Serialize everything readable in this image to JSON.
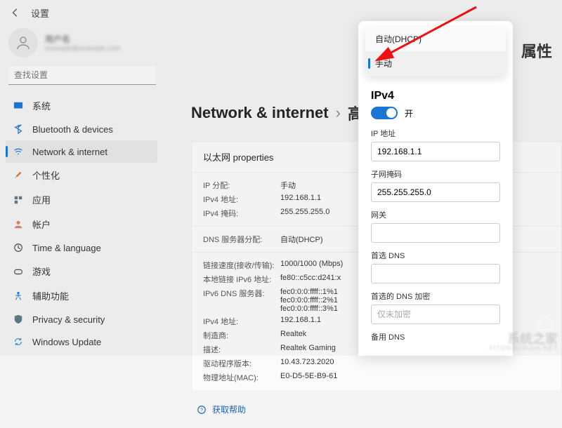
{
  "header": {
    "title": "设置"
  },
  "user": {
    "name": "用户名",
    "email": "example@example.com"
  },
  "search": {
    "placeholder": "查找设置"
  },
  "sidebar": {
    "items": [
      {
        "label": "系统",
        "icon_color": "#1976d2"
      },
      {
        "label": "Bluetooth & devices",
        "icon_color": "#1976d2"
      },
      {
        "label": "Network & internet",
        "icon_color": "#1976d2"
      },
      {
        "label": "个性化",
        "icon_color": "#e07b2e"
      },
      {
        "label": "应用",
        "icon_color": "#5a7a82"
      },
      {
        "label": "帐户",
        "icon_color": "#d28a6a"
      },
      {
        "label": "Time & language",
        "icon_color": "#444"
      },
      {
        "label": "游戏",
        "icon_color": "#444"
      },
      {
        "label": "辅助功能",
        "icon_color": "#2e7dd2"
      },
      {
        "label": "Privacy & security",
        "icon_color": "#5a7a82"
      },
      {
        "label": "Windows Update",
        "icon_color": "#3a98d6"
      }
    ]
  },
  "breadcrumb": {
    "main": "Network & internet",
    "sep": "›",
    "sub": "高",
    "suffix": "属性"
  },
  "card": {
    "title": "以太网 properties",
    "sections": [
      [
        {
          "label": "IP 分配:",
          "val": "手动"
        },
        {
          "label": "IPv4 地址:",
          "val": "192.168.1.1"
        },
        {
          "label": "IPv4 掩码:",
          "val": "255.255.255.0"
        }
      ],
      [
        {
          "label": "DNS 服务器分配:",
          "val": "自动(DHCP)"
        }
      ],
      [
        {
          "label": "链接速度(接收/传输):",
          "val": "1000/1000 (Mbps)"
        },
        {
          "label": "本地链接 IPv6 地址:",
          "val": "fe80::c5cc:d241:x"
        },
        {
          "label": "IPv6 DNS 服务器:",
          "val": "fec0:0:0:ffff::1%1\nfec0:0:0:ffff::2%1\nfec0:0:0:ffff::3%1"
        },
        {
          "label": "IPv4 地址:",
          "val": "192.168.1.1"
        },
        {
          "label": "制造商:",
          "val": "Realtek"
        },
        {
          "label": "描述:",
          "val": "Realtek Gaming"
        },
        {
          "label": "驱动程序版本:",
          "val": "10.43.723.2020"
        },
        {
          "label": "物理地址(MAC):",
          "val": "E0-D5-5E-B9-61"
        }
      ]
    ]
  },
  "help": {
    "label": "获取帮助"
  },
  "popup": {
    "dropdown": {
      "option_auto": "自动(DHCP)",
      "option_manual": "手动"
    },
    "ipv4_title": "IPv4",
    "toggle_on": "开",
    "fields": {
      "ip_label": "IP 地址",
      "ip_value": "192.168.1.1",
      "mask_label": "子网掩码",
      "mask_value": "255.255.255.0",
      "gateway_label": "网关",
      "gateway_value": "",
      "dns_label": "首选 DNS",
      "dns_value": "",
      "dnsenc_label": "首选的 DNS 加密",
      "dnsenc_placeholder": "仅未加密",
      "altdns_label": "备用 DNS"
    }
  },
  "watermark": {
    "brand": "系统之家",
    "domain": "XITONGZHIJIA.NET"
  }
}
